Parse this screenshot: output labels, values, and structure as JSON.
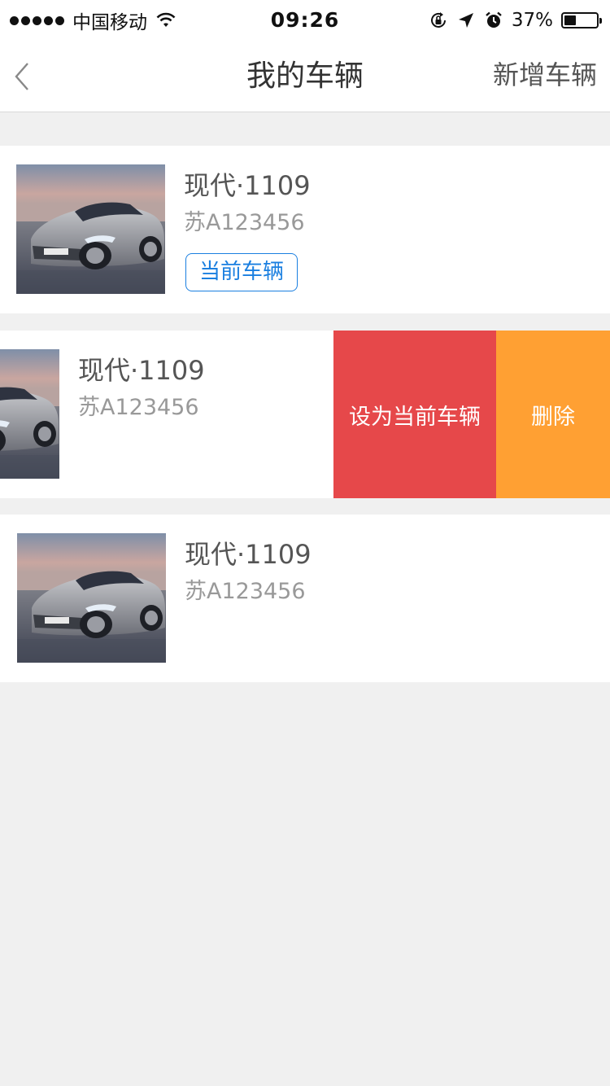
{
  "status_bar": {
    "carrier": "中国移动",
    "time": "09:26",
    "battery_percent": "37%",
    "battery_level": 0.37
  },
  "nav": {
    "title": "我的车辆",
    "add_label": "新增车辆"
  },
  "vehicles": [
    {
      "name": "现代·1109",
      "plate": "苏A123456",
      "badge": "当前车辆"
    },
    {
      "name": "现代·1109",
      "plate": "苏A123456"
    },
    {
      "name": "现代·1109",
      "plate": "苏A123456"
    }
  ],
  "swipe_actions": {
    "set_current_label": "设为当前车辆",
    "delete_label": "删除",
    "set_current_color": "#e6484a",
    "delete_color": "#ffa033"
  },
  "colors": {
    "background": "#f0f0f0",
    "accent_blue": "#1a7fe0"
  }
}
